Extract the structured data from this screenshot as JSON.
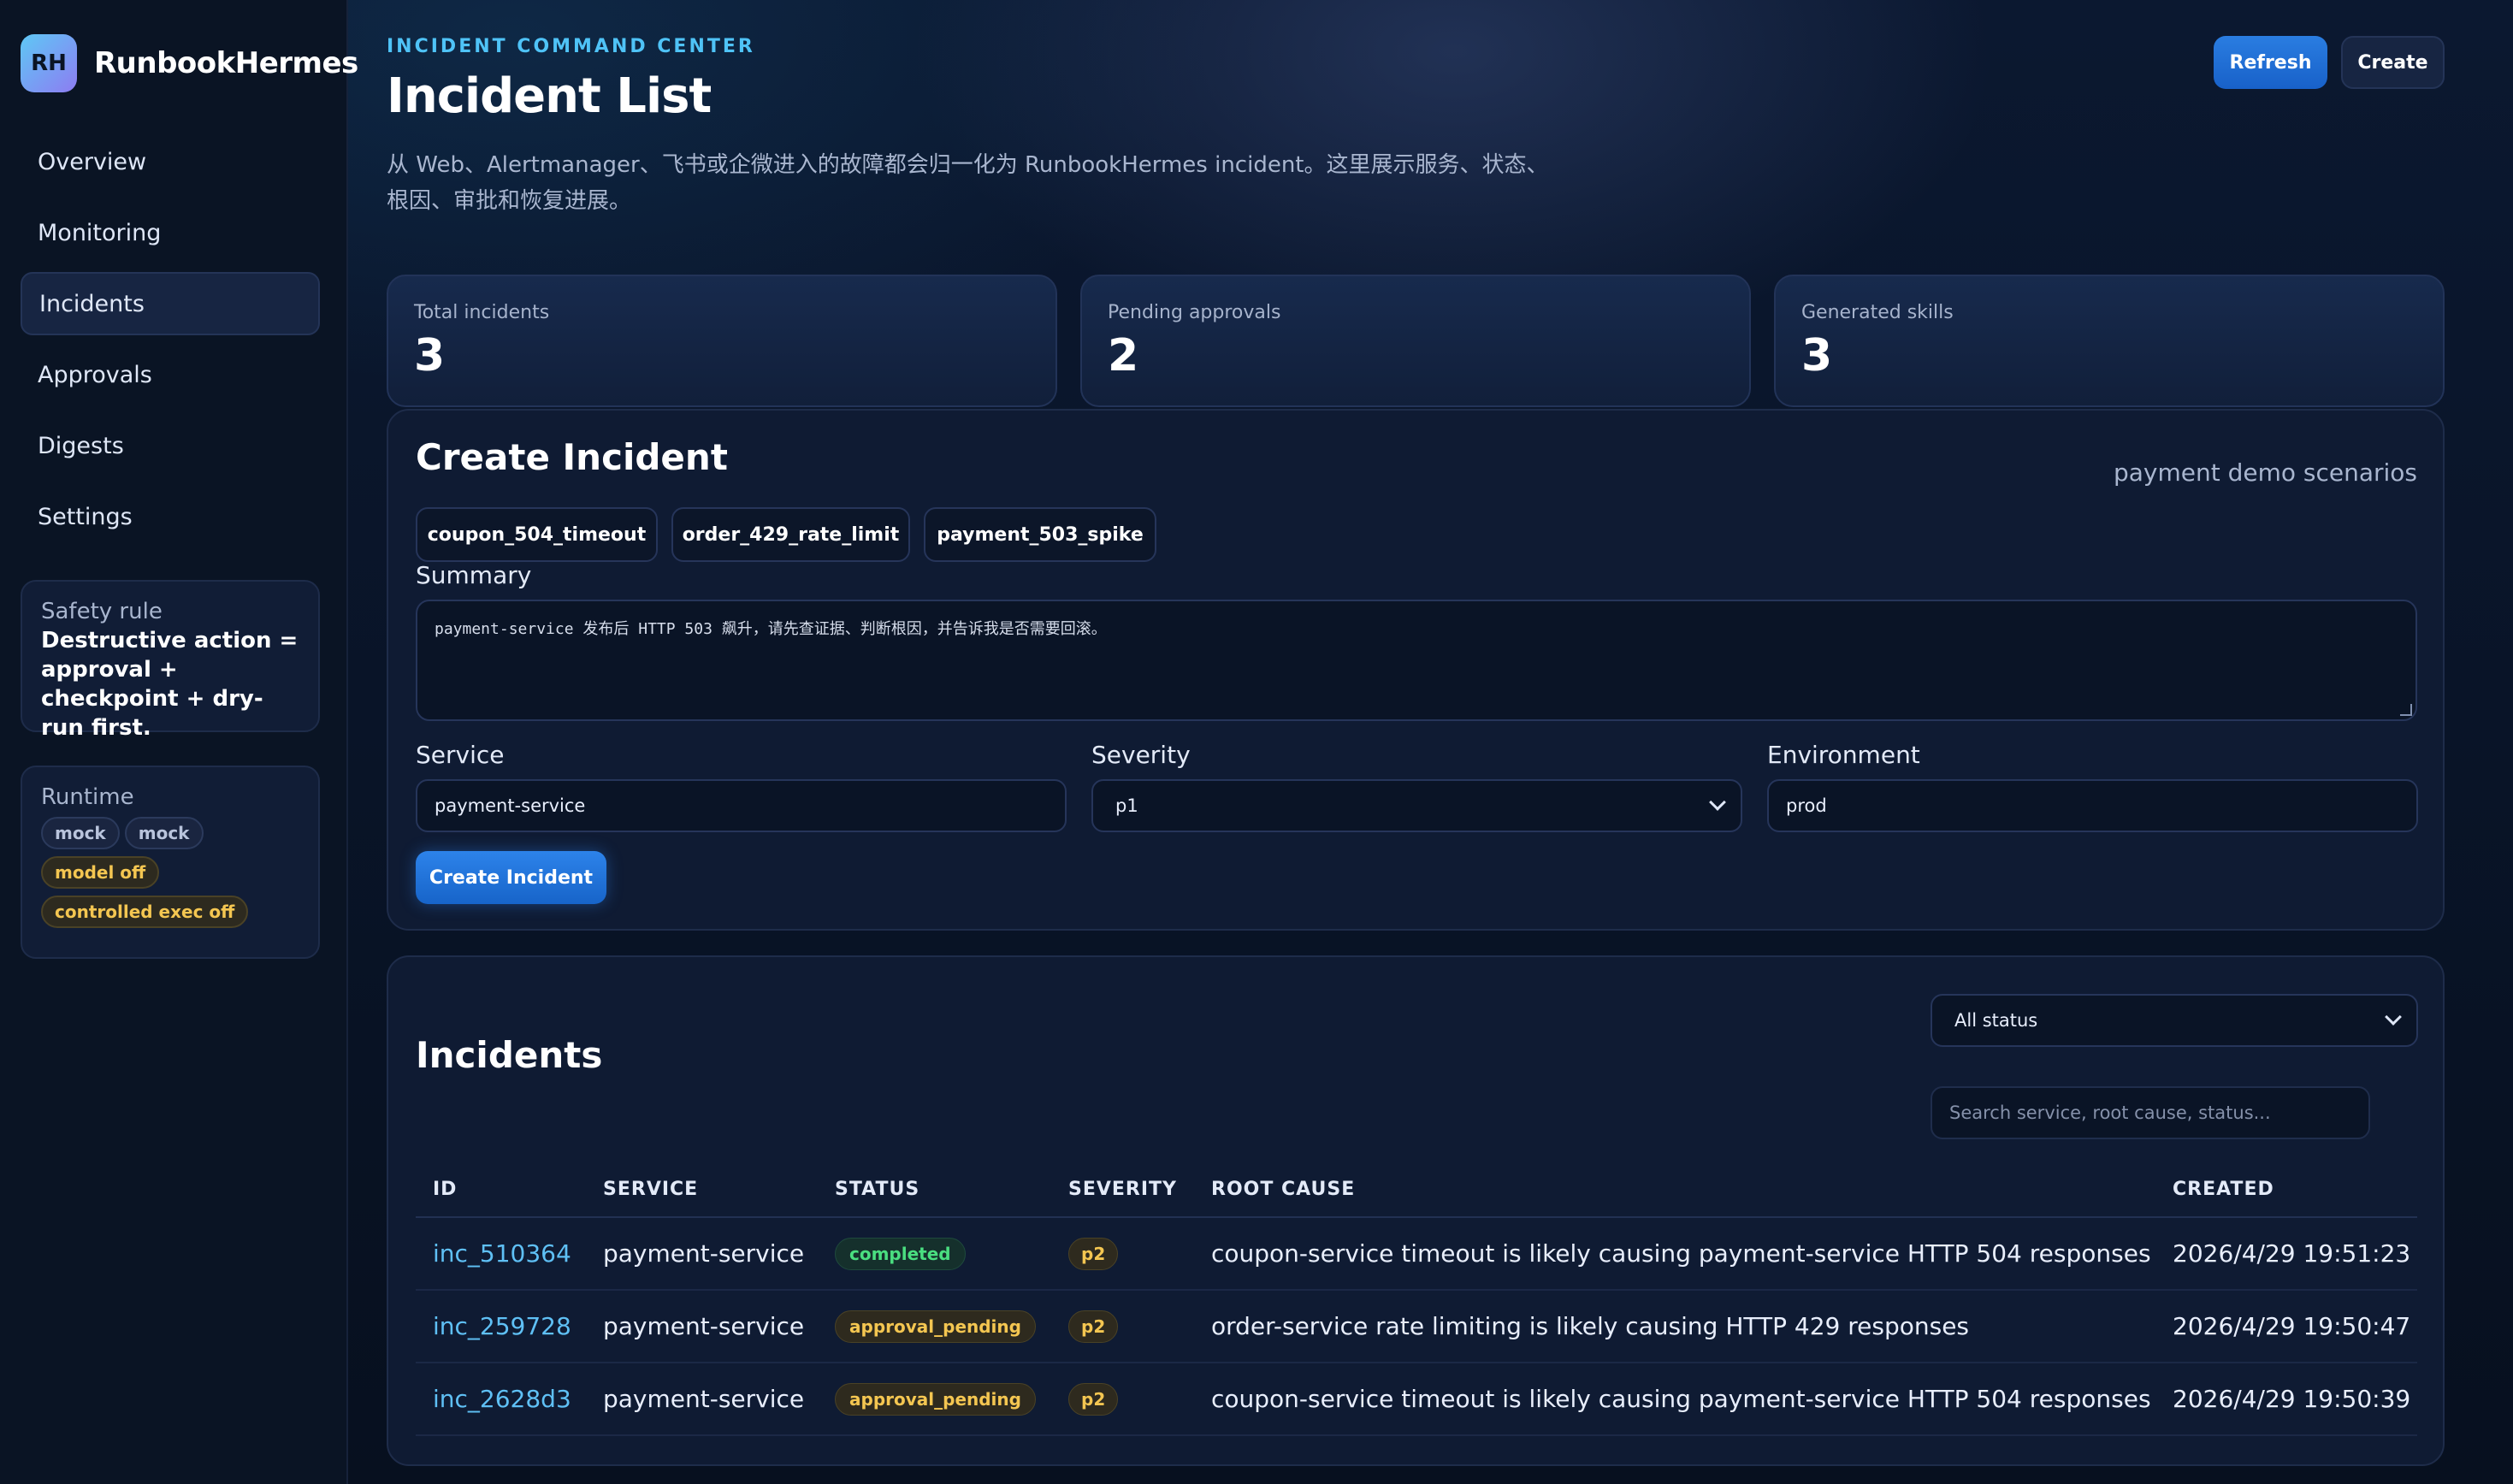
{
  "app": {
    "brand_initials": "RH",
    "brand_name": "RunbookHermes"
  },
  "sidebar": {
    "items": [
      {
        "label": "Overview"
      },
      {
        "label": "Monitoring"
      },
      {
        "label": "Incidents",
        "active": true
      },
      {
        "label": "Approvals"
      },
      {
        "label": "Digests"
      },
      {
        "label": "Settings"
      }
    ],
    "safety": {
      "label": "Safety rule",
      "text": "Destructive action = approval + checkpoint + dry-run first."
    },
    "runtime": {
      "label": "Runtime",
      "pills": [
        "mock",
        "mock",
        "model off",
        "controlled exec off"
      ]
    }
  },
  "header": {
    "eyebrow": "INCIDENT COMMAND CENTER",
    "title": "Incident List",
    "description": "从 Web、Alertmanager、飞书或企微进入的故障都会归一化为 RunbookHermes incident。这里展示服务、状态、根因、审批和恢复进展。",
    "refresh_label": "Refresh",
    "create_label": "Create"
  },
  "stats": [
    {
      "label": "Total incidents",
      "value": "3"
    },
    {
      "label": "Pending approvals",
      "value": "2"
    },
    {
      "label": "Generated skills",
      "value": "3"
    }
  ],
  "create_form": {
    "title": "Create Incident",
    "scenarios_label": "payment demo scenarios",
    "scenarios": [
      "coupon_504_timeout",
      "order_429_rate_limit",
      "payment_503_spike"
    ],
    "summary_label": "Summary",
    "summary_value": "payment-service 发布后 HTTP 503 飙升，请先查证据、判断根因，并告诉我是否需要回滚。",
    "service_label": "Service",
    "service_value": "payment-service",
    "severity_label": "Severity",
    "severity_value": "p1",
    "environment_label": "Environment",
    "environment_value": "prod",
    "submit_label": "Create Incident"
  },
  "incidents": {
    "title": "Incidents",
    "status_filter": "All status",
    "search_placeholder": "Search service, root cause, status...",
    "columns": [
      "ID",
      "SERVICE",
      "STATUS",
      "SEVERITY",
      "ROOT CAUSE",
      "CREATED"
    ],
    "rows": [
      {
        "id": "inc_510364",
        "service": "payment-service",
        "status": "completed",
        "severity": "p2",
        "root_cause": "coupon-service timeout is likely causing payment-service HTTP 504 responses",
        "created": "2026/4/29 19:51:23"
      },
      {
        "id": "inc_259728",
        "service": "payment-service",
        "status": "approval_pending",
        "severity": "p2",
        "root_cause": "order-service rate limiting is likely causing HTTP 429 responses",
        "created": "2026/4/29 19:50:47"
      },
      {
        "id": "inc_2628d3",
        "service": "payment-service",
        "status": "approval_pending",
        "severity": "p2",
        "root_cause": "coupon-service timeout is likely causing payment-service HTTP 504 responses",
        "created": "2026/4/29 19:50:39"
      }
    ]
  },
  "colors": {
    "accent": "#4fc3f7",
    "primary_button": "#1e6fd9",
    "success": "#4ade80",
    "warning": "#f4c651",
    "background": "#081225"
  }
}
